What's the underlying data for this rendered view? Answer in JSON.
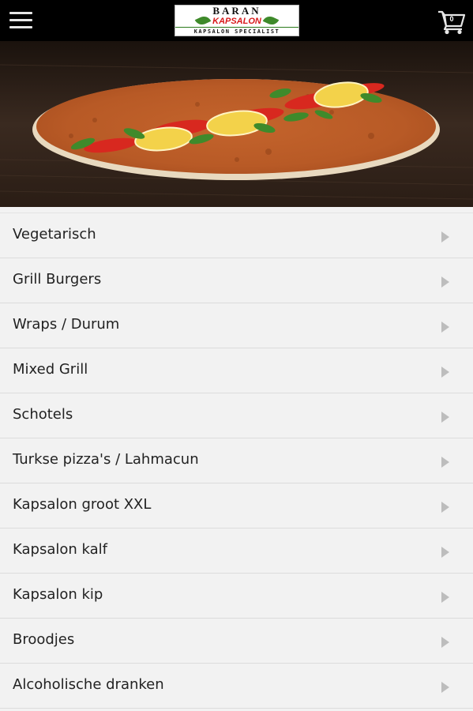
{
  "header": {
    "menu_icon": "hamburger-menu-icon",
    "logo": {
      "line1": "BARAN",
      "line2": "KAPSALON",
      "line3": "KAPSALON SPECIALIST"
    },
    "cart": {
      "icon": "shopping-cart-icon",
      "count": "0"
    }
  },
  "hero": {
    "image": "lahmacun-pizza-photo"
  },
  "categories": [
    {
      "label": "Vegetarisch"
    },
    {
      "label": "Grill Burgers"
    },
    {
      "label": "Wraps / Durum"
    },
    {
      "label": "Mixed Grill"
    },
    {
      "label": "Schotels"
    },
    {
      "label": "Turkse pizza's / Lahmacun"
    },
    {
      "label": "Kapsalon groot XXL"
    },
    {
      "label": "Kapsalon kalf"
    },
    {
      "label": "Kapsalon kip"
    },
    {
      "label": "Broodjes"
    },
    {
      "label": "Alcoholische dranken"
    }
  ],
  "colors": {
    "header_bg": "#000000",
    "list_bg": "#f2f2f2",
    "chevron": "#bdbdbd",
    "logo_red": "#d8191a",
    "logo_green": "#3e8a2a"
  }
}
